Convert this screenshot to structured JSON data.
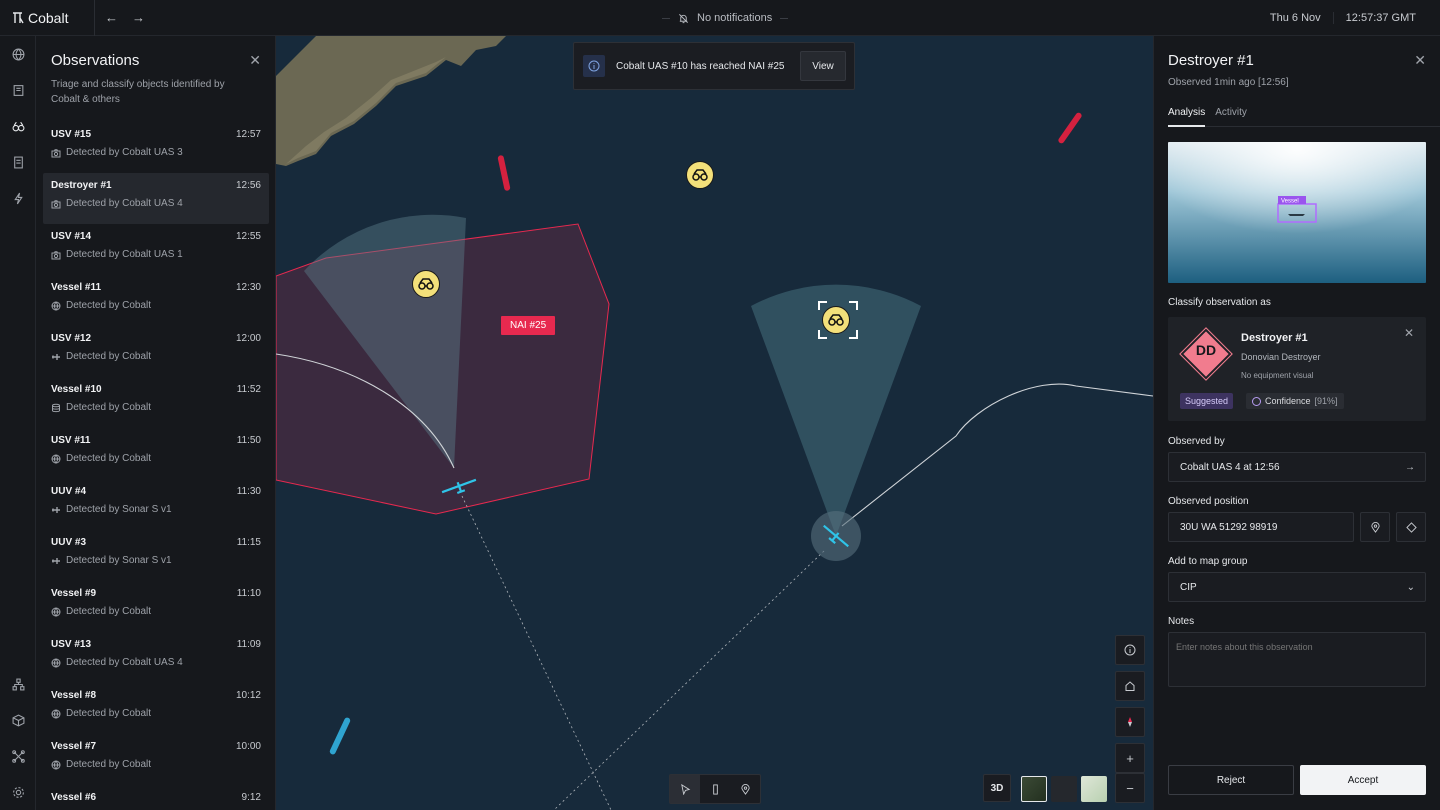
{
  "app": {
    "name": "Cobalt"
  },
  "topbar": {
    "notifications": "No notifications",
    "date": "Thu 6 Nov",
    "time": "12:57:37 GMT"
  },
  "observations": {
    "title": "Observations",
    "subtitle": "Triage and classify objects identified by Cobalt & others",
    "items": [
      {
        "name": "USV #15",
        "time": "12:57",
        "detected": "Detected by Cobalt UAS 3",
        "icon": "camera-icon"
      },
      {
        "name": "Destroyer #1",
        "time": "12:56",
        "detected": "Detected by Cobalt UAS 4",
        "icon": "camera-icon",
        "selected": true
      },
      {
        "name": "USV #14",
        "time": "12:55",
        "detected": "Detected by Cobalt UAS 1",
        "icon": "camera-icon"
      },
      {
        "name": "Vessel #11",
        "time": "12:30",
        "detected": "Detected by Cobalt",
        "icon": "globe-icon"
      },
      {
        "name": "USV #12",
        "time": "12:00",
        "detected": "Detected by Cobalt",
        "icon": "aircraft-icon"
      },
      {
        "name": "Vessel #10",
        "time": "11:52",
        "detected": "Detected by Cobalt",
        "icon": "database-icon"
      },
      {
        "name": "USV #11",
        "time": "11:50",
        "detected": "Detected by Cobalt",
        "icon": "globe-icon"
      },
      {
        "name": "UUV #4",
        "time": "11:30",
        "detected": "Detected by Sonar S v1",
        "icon": "aircraft-icon"
      },
      {
        "name": "UUV #3",
        "time": "11:15",
        "detected": "Detected by Sonar S v1",
        "icon": "aircraft-icon"
      },
      {
        "name": "Vessel #9",
        "time": "11:10",
        "detected": "Detected by Cobalt",
        "icon": "globe-icon"
      },
      {
        "name": "USV #13",
        "time": "11:09",
        "detected": "Detected by Cobalt UAS 4",
        "icon": "globe-icon"
      },
      {
        "name": "Vessel #8",
        "time": "10:12",
        "detected": "Detected by Cobalt",
        "icon": "globe-icon"
      },
      {
        "name": "Vessel #7",
        "time": "10:00",
        "detected": "Detected by Cobalt",
        "icon": "globe-icon"
      },
      {
        "name": "Vessel #6",
        "time": "9:12",
        "detected": "",
        "icon": ""
      }
    ]
  },
  "map": {
    "toast": {
      "message": "Cobalt UAS #10 has reached NAI #25",
      "action": "View"
    },
    "nai_label": "NAI #25",
    "btn_3d": "3D"
  },
  "detail": {
    "title": "Destroyer #1",
    "observed": "Observed 1min ago [12:56]",
    "tabs": [
      "Analysis",
      "Activity"
    ],
    "photo_tag": "Vessel",
    "classify_label": "Classify observation as",
    "classification": {
      "code": "DD",
      "name": "Destroyer #1",
      "type": "Donovian Destroyer",
      "equipment": "No equipment visual",
      "suggested": "Suggested",
      "confidence_label": "Confidence",
      "confidence_value": "[91%]"
    },
    "observed_by_label": "Observed by",
    "observed_by": "Cobalt UAS 4 at 12:56",
    "position_label": "Observed position",
    "position": "30U WA 51292 98919",
    "map_group_label": "Add to map group",
    "map_group": "CIP",
    "notes_label": "Notes",
    "notes_placeholder": "Enter notes about this observation",
    "reject": "Reject",
    "accept": "Accept"
  },
  "colors": {
    "accent_nai": "#e7294f",
    "map_water": "#172a3b",
    "poi": "#f3e07a",
    "uav": "#2fc4e8",
    "vessel_hostile": "#d4213f"
  }
}
